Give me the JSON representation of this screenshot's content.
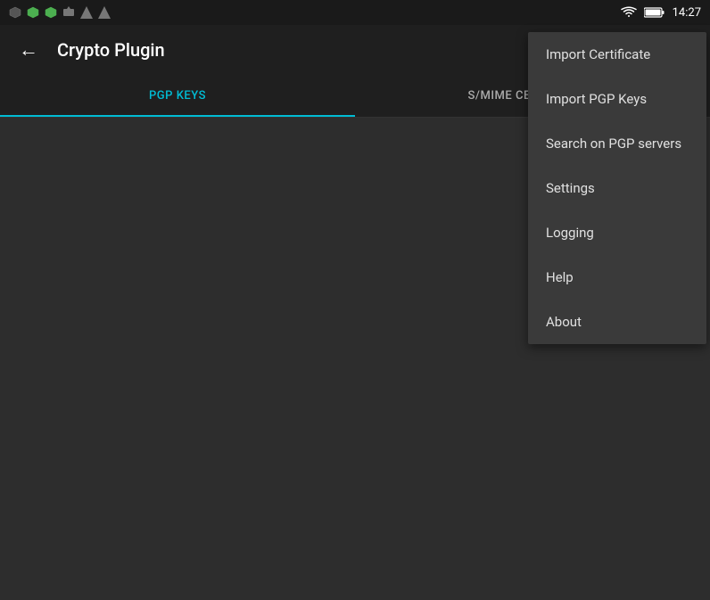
{
  "statusBar": {
    "time": "14:27"
  },
  "toolbar": {
    "title": "Crypto Plugin",
    "backLabel": "←"
  },
  "tabs": [
    {
      "id": "pgp-keys",
      "label": "PGP KEYS",
      "active": true
    },
    {
      "id": "smime",
      "label": "S/MIME CERTIFICATES",
      "active": false
    }
  ],
  "dropdownMenu": {
    "items": [
      {
        "id": "import-certificate",
        "label": "Import Certificate"
      },
      {
        "id": "import-pgp-keys",
        "label": "Import PGP Keys"
      },
      {
        "id": "search-pgp-servers",
        "label": "Search on PGP servers"
      },
      {
        "id": "settings",
        "label": "Settings"
      },
      {
        "id": "logging",
        "label": "Logging"
      },
      {
        "id": "help",
        "label": "Help"
      },
      {
        "id": "about",
        "label": "About"
      }
    ]
  },
  "colors": {
    "accent": "#00bcd4",
    "toolbar": "#1f1f1f",
    "background": "#2d2d2d",
    "dropdownBg": "#3a3a3a",
    "statusBar": "#1a1a1a"
  }
}
